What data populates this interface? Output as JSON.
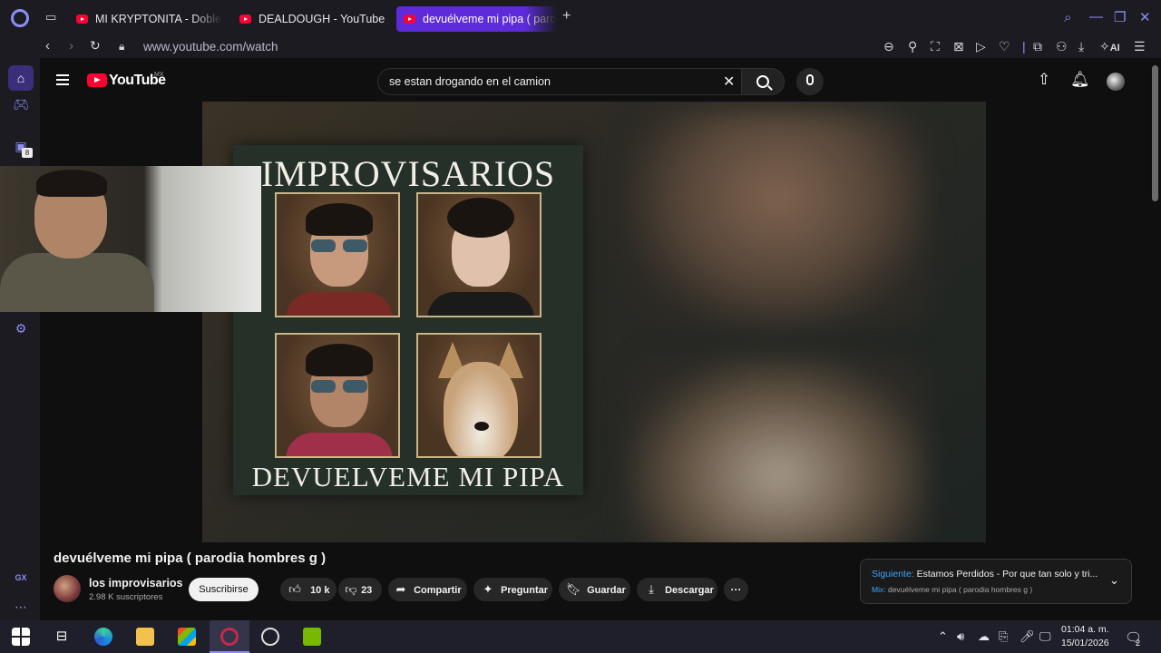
{
  "browser": {
    "tabs": [
      {
        "title": "MI KRYPTONITA - Doble O",
        "active": false
      },
      {
        "title": "DEALDOUGH - YouTube",
        "active": false
      },
      {
        "title": "devuélveme mi pipa ( paro",
        "active": true
      }
    ],
    "new_tab": "+",
    "url": "www.youtube.com/watch",
    "ai_label": "AI",
    "sidebar_badge": "8",
    "sidebar_label_gx": "GX",
    "accent": "#5e2bdb"
  },
  "youtube": {
    "logo_text": "YouTube",
    "region": "MX",
    "search_query": "se estan drogando en el camion"
  },
  "video": {
    "poster_title": "IMPROVISARIOS",
    "poster_subtitle": "DEVUELVEME MI PIPA",
    "title": "devuélveme mi pipa ( parodia hombres g )",
    "channel_name": "los improvisarios",
    "subscribers": "2.98 K suscriptores",
    "subscribe_label": "Suscribirse",
    "likes": "10 k",
    "dislikes": "23",
    "share_label": "Compartir",
    "ask_label": "Preguntar",
    "save_label": "Guardar",
    "download_label": "Descargar",
    "more_label": "···"
  },
  "up_next": {
    "prefix": "Siguiente:",
    "next_title": "Estamos Perdidos - Por que tan solo y tri...",
    "mix_prefix": "Mix:",
    "mix_title": "devuélveme mi pipa ( parodia hombres g )"
  },
  "taskbar": {
    "time": "01:04 a. m.",
    "date": "15/01/2026",
    "notifications": "2"
  }
}
